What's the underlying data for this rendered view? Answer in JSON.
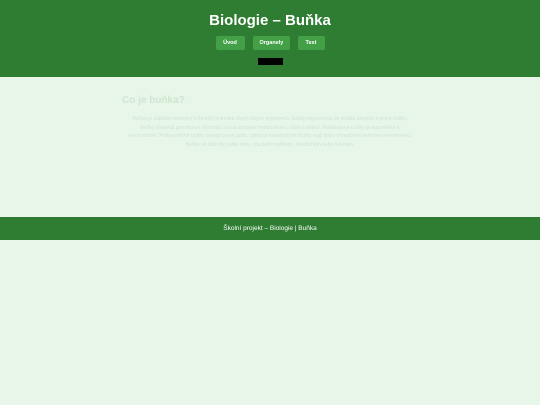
{
  "header": {
    "title": "Biologie – Buňka",
    "nav": [
      {
        "label": "Úvod"
      },
      {
        "label": "Organely"
      },
      {
        "label": "Test"
      }
    ]
  },
  "main": {
    "section_title": "Co je buňka?",
    "section_text": "Buňka je základní stavební a funkční jednotka všech živých organismů. Každý organismus se skládá alespoň z jedné buňky. Buňky obsahují genetickou informaci a jsou schopné metabolismu, růstu a dělení. Rozlišujeme buňky prokaryotické a eukaryotické. Prokaryotické buňky nemají pravé jádro, zatímco eukaryotické buňky mají jádro ohraničené jadernou membránou. Buňky se dále liší podle toho, zda patří rostlinám, živočichům nebo houbám."
  },
  "footer": {
    "text": "Školní projekt – Biologie | Buňka"
  },
  "colors": {
    "header_bg": "#2e7d32",
    "nav_button_bg": "#43a047",
    "page_bg": "#e8f5e9",
    "footer_bg": "#2e7d32",
    "faint_text": "#cfe6d0"
  }
}
